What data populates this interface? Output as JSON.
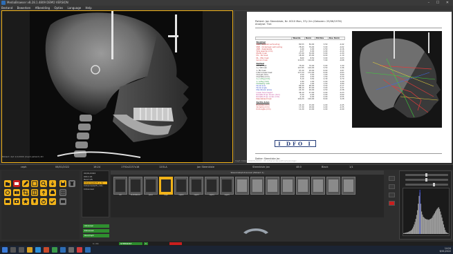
{
  "window": {
    "title": "MediaBrowser v8.28.1.4809 DEMO VERSION",
    "controls": "–  ☐  ✕"
  },
  "menu": [
    "Bestand",
    "Bewerken",
    "Afbeelding",
    "Opties",
    "Language",
    "Help"
  ],
  "xray_caption": "Patient: dpt 1/1/2000 (Ceph patient) 2D",
  "doc_caption": "Ceph Index: 000/01/2022 - 2C /r/Cervical/ pathophysiologic",
  "report": {
    "header_line1": "Patient: Jan Steenkiste, Nr. 0010 Man, 37y 2m (Geboren: 25/06/1976)",
    "header_line2": "Analyse: Tick",
    "columns": [
      "",
      "Waarde",
      "Norm",
      "Std Dev",
      "Dev. Norm"
    ],
    "sections": [
      {
        "title": "Skeletaal",
        "rows": [
          {
            "label": "SNA - Schedel verhouding",
            "values": [
              "80,53",
              "82,00",
              "3,50",
              "-0,42"
            ],
            "color": "#d23c3c"
          },
          {
            "label": "SNB - Onderkaak verhouding",
            "values": [
              "78,93",
              "79,00",
              "3,00",
              "-0,02"
            ],
            "color": "#d23c3c"
          },
          {
            "label": "ANB - Kaakrelatie",
            "values": [
              "1,60",
              "2,00",
              "2,50",
              "-0,16"
            ],
            "color": "#d23c3c"
          },
          {
            "label": "Wits waarde (mm)",
            "values": [
              "-0,27",
              "0,00",
              "2,00",
              "-0,14"
            ],
            "color": "#d23c3c"
          },
          {
            "label": "NS-ML hoek",
            "values": [
              "27,00",
              "32,00",
              "5,00",
              "-1,00"
            ],
            "color": "#d23c3c"
          },
          {
            "label": "ML - NL hoek",
            "values": [
              "18,40",
              "25,00",
              "6,00",
              "-1,10"
            ],
            "color": "#d23c3c"
          },
          {
            "label": "NL - NSL hoek",
            "values": [
              "8,60",
              "8,50",
              "3,00",
              "0,03"
            ],
            "color": "#d23c3c"
          },
          {
            "label": "Gonion hoek",
            "values": [
              "119,25",
              "124,00",
              "7,00",
              "-0,68"
            ],
            "color": "#d23c3c"
          }
        ]
      },
      {
        "title": "Dentaal",
        "rows": [
          {
            "label": "1+ NL hoek",
            "values": [
              "75,00",
              "70,00",
              "5,00",
              "1,00"
            ],
            "color": "#333333"
          },
          {
            "label": "1+ SN hoek",
            "values": [
              "107,85",
              "102,00",
              "5,50",
              "1,06"
            ],
            "color": "#333333"
          },
          {
            "label": "1- ML hoek",
            "values": [
              "97,20",
              "92,00",
              "6,00",
              "0,87"
            ],
            "color": "#333333"
          },
          {
            "label": "Interincisaal hoek",
            "values": [
              "127,20",
              "131,00",
              "6,00",
              "-0,63"
            ],
            "color": "#333333"
          },
          {
            "label": "Overjet (mm)",
            "values": [
              "2,50",
              "2,50",
              "1,00",
              "0,00"
            ],
            "color": "#333333"
          },
          {
            "label": "Overbite (mm)",
            "values": [
              "2,00",
              "2,50",
              "1,50",
              "-0,33"
            ],
            "color": "#333333"
          },
          {
            "label": "1+ A-Pog (mm)",
            "values": [
              "5,10",
              "3,50",
              "2,30",
              "0,70"
            ],
            "color": "#1f8a3a"
          },
          {
            "label": "1- A-Pog (mm)",
            "values": [
              "1,80",
              "1,00",
              "2,00",
              "0,40"
            ],
            "color": "#1f8a3a"
          },
          {
            "label": "Holdaway ratio",
            "values": [
              "2,20",
              "1,00",
              "1,50",
              "0,80"
            ],
            "color": "#1f8a3a"
          },
          {
            "label": "Facial axis",
            "values": [
              "89,40",
              "90,00",
              "3,50",
              "-0,17"
            ],
            "color": "#2f4fc8"
          },
          {
            "label": "Facial angle",
            "values": [
              "88,10",
              "87,00",
              "3,00",
              "0,37"
            ],
            "color": "#2f4fc8"
          },
          {
            "label": "Mandibular plane",
            "values": [
              "24,30",
              "26,00",
              "4,50",
              "-0,38"
            ],
            "color": "#2f4fc8"
          },
          {
            "label": "Lower face height",
            "values": [
              "46,10",
              "47,00",
              "4,00",
              "-0,23"
            ],
            "color": "#c04a9a"
          },
          {
            "label": "Ricketts E-lijn boven (mm)",
            "values": [
              "-3,20",
              "-2,00",
              "2,00",
              "-0,60"
            ],
            "color": "#c04a9a"
          },
          {
            "label": "Ricketts E-lijn onder (mm)",
            "values": [
              "-1,10",
              "0,00",
              "2,00",
              "-0,55"
            ],
            "color": "#c04a9a"
          },
          {
            "label": "Nasolabiaal hoek",
            "values": [
              "104,20",
              "102,00",
              "8,00",
              "0,28"
            ],
            "color": "#d23c3c"
          }
        ]
      },
      {
        "title": "Zachte delen",
        "rows": [
          {
            "label": "Bovenlip (mm)",
            "values": [
              "14,10",
              "15,00",
              "2,00",
              "-0,45"
            ],
            "color": "#d23c3c"
          },
          {
            "label": "Onderlip (mm)",
            "values": [
              "17,30",
              "18,00",
              "2,00",
              "-0,35"
            ],
            "color": "#d23c3c"
          },
          {
            "label": "Kinhoogte (mm)",
            "values": [
              "11,20",
              "12,00",
              "2,00",
              "-0,40"
            ],
            "color": "#d23c3c"
          }
        ]
      }
    ],
    "logo_text": "I DFO I",
    "footer": "Dokter: Steenkiste Jan"
  },
  "infostrip": {
    "c1": "ceph",
    "c2": "06/01/2022",
    "c3": "16:24",
    "c4": "1792x2237x16",
    "c5": "12OLA",
    "c6": "Jan Steenkiste",
    "c7": "Steenkiste Jan",
    "c8": "48:0",
    "c9": "Black",
    "c10": "1/1"
  },
  "tree": {
    "rows": [
      "00/01/2022",
      "0011:24",
      "HA17:25",
      "Intraoraal(1/5 + 1)",
      "Intraoraal(25 | 12)",
      "Intraoraal"
    ],
    "selected_index": 3
  },
  "thumbs": {
    "header": "Steenkiste/Intraoraal (Patient 1)",
    "items": [
      {
        "label": "rim"
      },
      {
        "label": "B-CEANLD2"
      },
      {
        "label": "pano"
      },
      {
        "label": "ceph"
      },
      {
        "label": "ceph2"
      },
      {
        "label": "ceph3"
      },
      {
        "label": "ceph4"
      },
      {
        "label": "ceph5"
      },
      {
        "label": ""
      },
      {
        "label": ""
      },
      {
        "label": ""
      },
      {
        "label": ""
      },
      {
        "label": ""
      },
      {
        "label": ""
      },
      {
        "label": ""
      },
      {
        "label": ""
      }
    ],
    "active_index": 3
  },
  "green_bars": [
    "Intraoraal",
    "Extraoraal",
    "Pano/Ceph"
  ],
  "status": {
    "left": "1 / 11",
    "green_label": "STEENKIST",
    "green2": "1"
  },
  "histogram": {
    "series": [
      2,
      2,
      3,
      3,
      4,
      4,
      5,
      6,
      7,
      8,
      10,
      13,
      17,
      22,
      28,
      35,
      44,
      55,
      70,
      88,
      96,
      70,
      52,
      45,
      40,
      38,
      36,
      35,
      34,
      34,
      33,
      33,
      34,
      35,
      36,
      38,
      42,
      45,
      48,
      52,
      55,
      58,
      60,
      62,
      58,
      52,
      45,
      38,
      30,
      22,
      15,
      9,
      5,
      3,
      2,
      1
    ],
    "marker_index": 20
  },
  "taskbar": {
    "time": "14:24",
    "date": "6/01/2022"
  },
  "colors": {
    "accent": "#f2b318",
    "green": "#2f8f2f",
    "red": "#c81e1e",
    "histogram_marker": "#3b4ee0"
  }
}
